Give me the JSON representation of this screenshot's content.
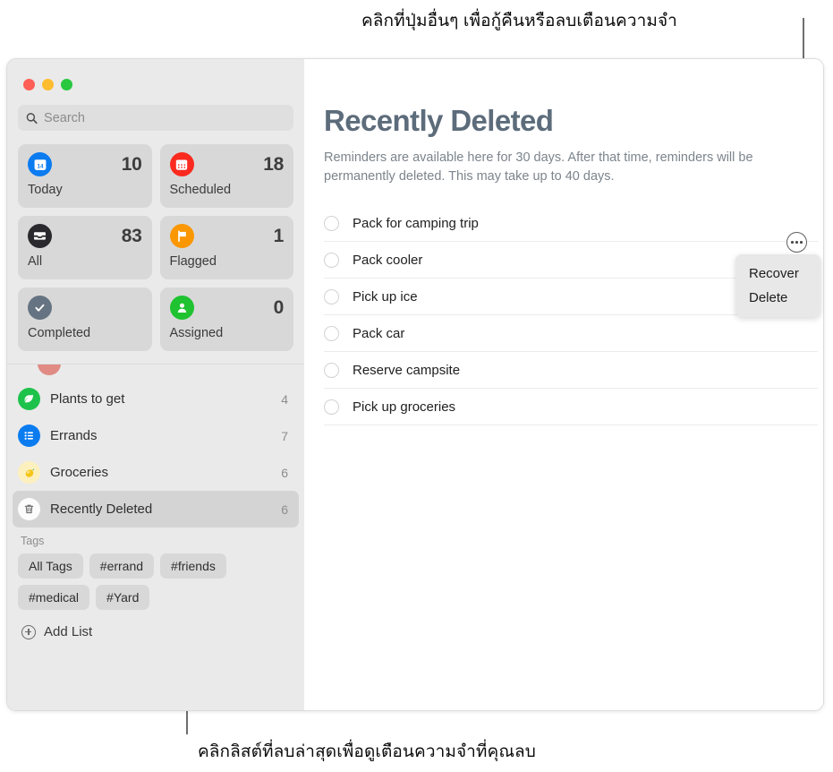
{
  "annotations": {
    "top_callout": "คลิกที่ปุ่มอื่นๆ เพื่อกู้คืนหรือลบเตือนความจำ",
    "bottom_callout": "คลิกลิสต์ที่ลบล่าสุดเพื่อดูเตือนความจำที่คุณลบ"
  },
  "window": {
    "traffic_lights": [
      "close",
      "minimize",
      "zoom"
    ],
    "colors": {
      "close": "#ff5f57",
      "minimize": "#febc2e",
      "zoom": "#28c840"
    }
  },
  "sidebar": {
    "search": {
      "placeholder": "Search",
      "value": "",
      "icon": "search-icon"
    },
    "quick_access": [
      {
        "label": "Today",
        "count": "10",
        "icon": "calendar-day-icon",
        "color": "#0b7bf0"
      },
      {
        "label": "Scheduled",
        "count": "18",
        "icon": "calendar-icon",
        "color": "#fb2a1f"
      },
      {
        "label": "All",
        "count": "83",
        "icon": "inbox-tray-icon",
        "color": "#2a2a2e"
      },
      {
        "label": "Flagged",
        "count": "1",
        "icon": "flag-icon",
        "color": "#fb9700"
      },
      {
        "label": "Completed",
        "count": "",
        "icon": "checkmark-icon",
        "color": "#667382"
      },
      {
        "label": "Assigned",
        "count": "0",
        "icon": "person-icon",
        "color": "#1fc230"
      }
    ],
    "lists": [
      {
        "label": "Plants to get",
        "count": "4",
        "icon": "leaf-icon",
        "selected": false
      },
      {
        "label": "Errands",
        "count": "7",
        "icon": "list-icon",
        "selected": false
      },
      {
        "label": "Groceries",
        "count": "6",
        "icon": "lemon-icon",
        "selected": false
      },
      {
        "label": "Recently Deleted",
        "count": "6",
        "icon": "trash-icon",
        "selected": true
      }
    ],
    "tags_title": "Tags",
    "tags": [
      "All Tags",
      "#errand",
      "#friends",
      "#medical",
      "#Yard"
    ],
    "add_list_label": "Add List",
    "add_list_icon": "plus-circle-icon"
  },
  "main": {
    "title": "Recently Deleted",
    "description": "Reminders are available here for 30 days. After that time, reminders will be permanently deleted. This may take up to 40 days.",
    "title_color": "#5d6c7b",
    "reminders": [
      "Pack for camping trip",
      "Pack cooler",
      "Pick up ice",
      "Pack car",
      "Reserve campsite",
      "Pick up groceries"
    ],
    "more_button_icon": "ellipsis-circle-icon",
    "popup_menu": [
      "Recover",
      "Delete"
    ]
  }
}
